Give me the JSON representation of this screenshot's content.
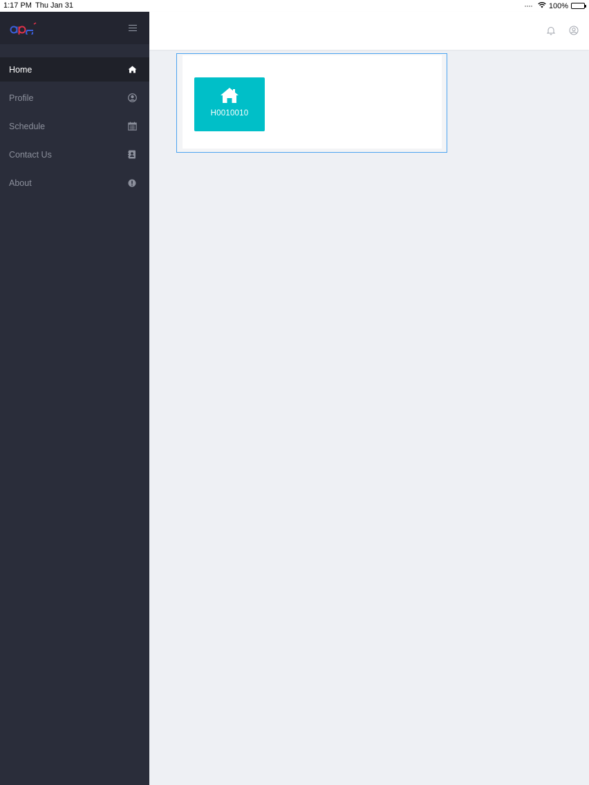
{
  "status_bar": {
    "time": "1:17 PM",
    "date": "Thu Jan 31",
    "battery": "100%"
  },
  "sidebar": {
    "logo_text": "ape",
    "items": [
      {
        "label": "Home",
        "icon": "home-icon",
        "active": true
      },
      {
        "label": "Profile",
        "icon": "user-circle-icon",
        "active": false
      },
      {
        "label": "Schedule",
        "icon": "calendar-icon",
        "active": false
      },
      {
        "label": "Contact Us",
        "icon": "address-book-icon",
        "active": false
      },
      {
        "label": "About",
        "icon": "info-circle-icon",
        "active": false
      }
    ]
  },
  "header": {
    "icons": [
      "bell-icon",
      "user-icon"
    ]
  },
  "main": {
    "tiles": [
      {
        "label": "H0010010",
        "icon": "house-icon"
      }
    ]
  },
  "colors": {
    "sidebar_bg": "#2a2d3a",
    "sidebar_active_bg": "#1f2129",
    "tile_accent": "#00bfc8",
    "panel_border": "#4aa3f0",
    "page_bg": "#eef0f4"
  }
}
